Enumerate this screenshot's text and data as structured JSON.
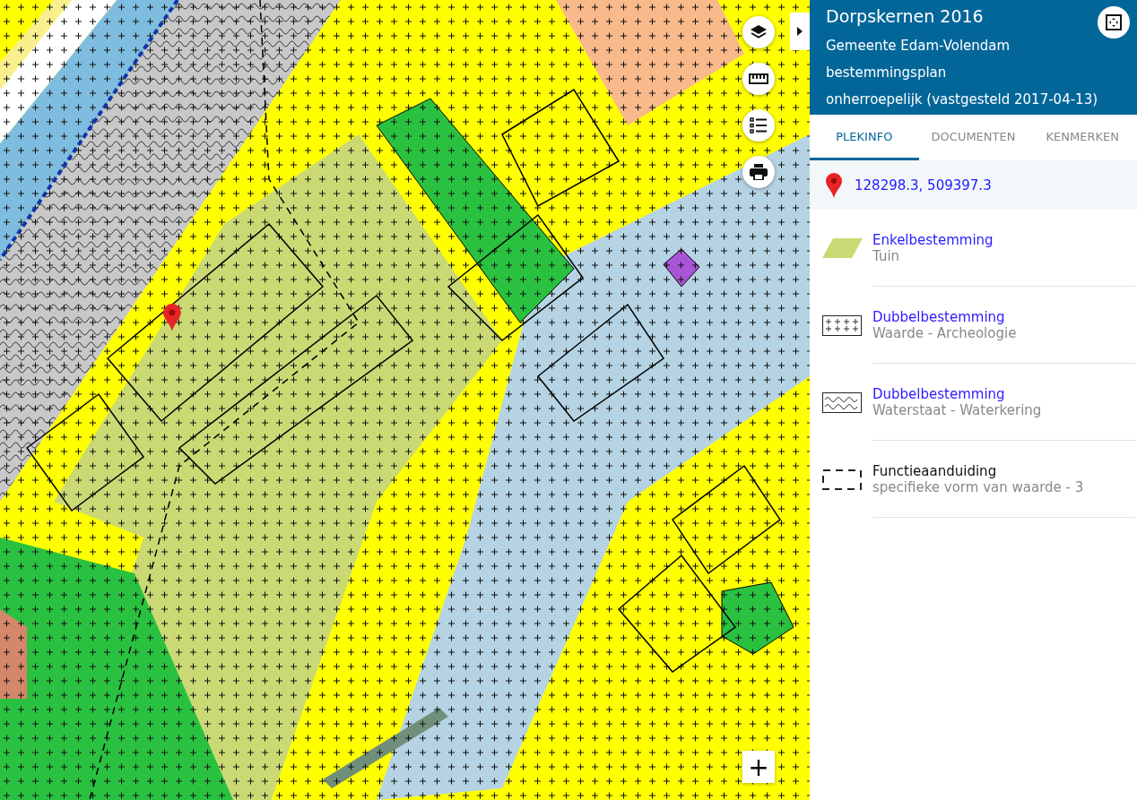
{
  "map": {
    "controls": [
      {
        "kind": "layers"
      },
      {
        "kind": "measure"
      },
      {
        "kind": "legend"
      },
      {
        "kind": "print"
      }
    ],
    "zoom_in": "+"
  },
  "panel": {
    "title": "Dorpskernen 2016",
    "subtitle_lines": [
      "Gemeente Edam-Volendam",
      "bestemmingsplan",
      "onherroepelijk (vastgesteld 2017-04-13)"
    ],
    "tabs": [
      {
        "label": "PLEKINFO",
        "selected": true
      },
      {
        "label": "DOCUMENTEN",
        "selected": false
      },
      {
        "label": "KENMERKEN",
        "selected": false
      }
    ],
    "location": "128298.3, 509397.3",
    "items": [
      {
        "kind": "fill",
        "title": "Enkelbestemming",
        "link": true,
        "subtitle": "Tuin"
      },
      {
        "kind": "crosses",
        "title": "Dubbelbestemming",
        "link": true,
        "subtitle": "Waarde - Archeologie"
      },
      {
        "kind": "waves",
        "title": "Dubbelbestemming",
        "link": true,
        "subtitle": "Waterstaat - Waterkering"
      },
      {
        "kind": "dashed",
        "title": "Functieaanduiding",
        "link": false,
        "subtitle": "specifieke vorm van waarde - 3"
      }
    ]
  }
}
